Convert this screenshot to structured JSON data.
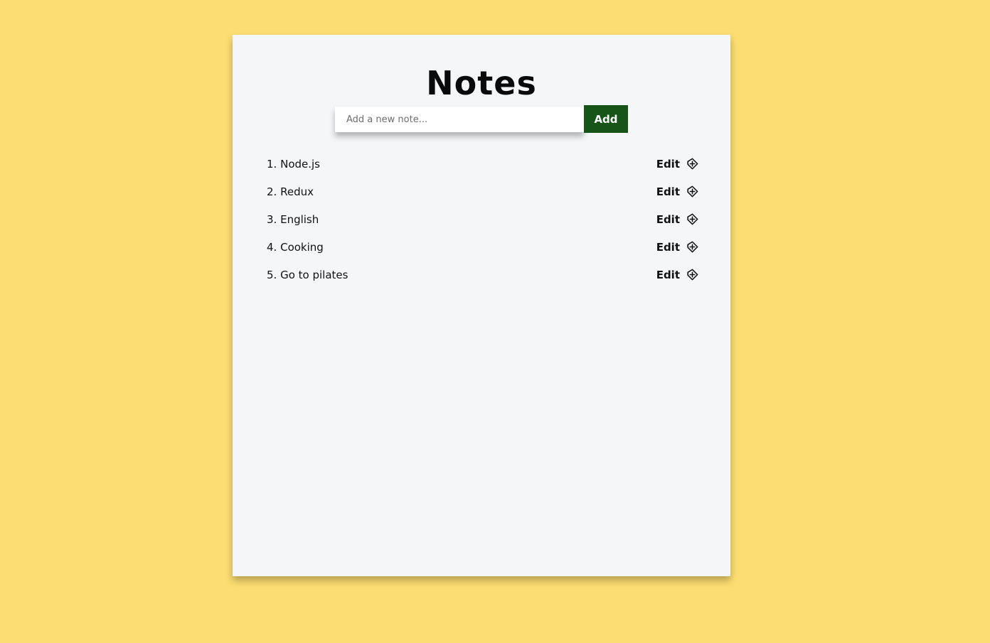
{
  "app": {
    "title": "Notes"
  },
  "form": {
    "placeholder": "Add a new note...",
    "value": "",
    "add_label": "Add"
  },
  "notes": [
    {
      "index": "1.",
      "text": "Node.js",
      "edit_label": "Edit"
    },
    {
      "index": "2.",
      "text": "Redux",
      "edit_label": "Edit"
    },
    {
      "index": "3.",
      "text": "English",
      "edit_label": "Edit"
    },
    {
      "index": "4.",
      "text": "Cooking",
      "edit_label": "Edit"
    },
    {
      "index": "5.",
      "text": "Go to pilates",
      "edit_label": "Edit"
    }
  ],
  "icons": {
    "edit": "edit-icon"
  },
  "colors": {
    "background": "#fcdd71",
    "card": "#f4f6f8",
    "add_button": "#165418"
  }
}
